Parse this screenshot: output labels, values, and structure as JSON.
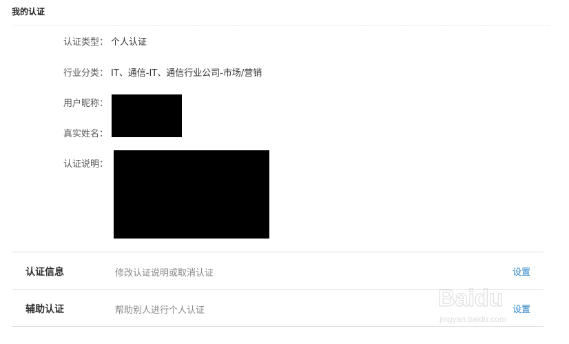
{
  "section": {
    "title": "我的认证"
  },
  "fields": {
    "cert_type": {
      "label": "认证类型：",
      "value": "个人认证"
    },
    "industry": {
      "label": "行业分类：",
      "value": "IT、通信-IT、通信行业公司-市场/营销"
    },
    "nickname": {
      "label": "用户昵称："
    },
    "real_name": {
      "label": "真实姓名："
    },
    "cert_desc": {
      "label": "认证说明："
    }
  },
  "rows": [
    {
      "title": "认证信息",
      "desc": "修改认证说明或取消认证",
      "link": "设置"
    },
    {
      "title": "辅助认证",
      "desc": "帮助别人进行个人认证",
      "link": "设置"
    }
  ],
  "watermark": {
    "brand": "Baidu",
    "sub": "jingyan.baidu.com"
  },
  "colors": {
    "link": "#2e87c8",
    "redaction": "#000000",
    "divider": "#dedede"
  }
}
